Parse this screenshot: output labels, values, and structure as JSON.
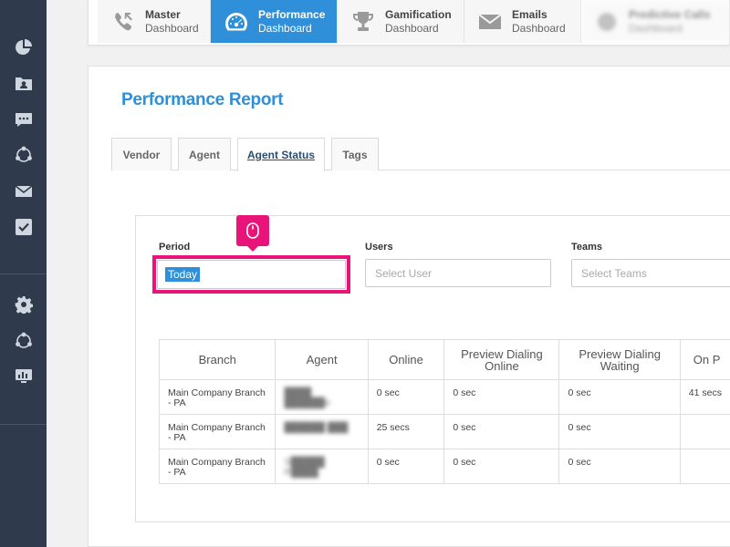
{
  "sidebar": {
    "icons": [
      "pie-chart-icon",
      "contacts-folder-icon",
      "chat-icon",
      "network-icon",
      "mail-icon",
      "checkbox-icon",
      "gear-icon",
      "network-icon",
      "monitor-chart-icon"
    ]
  },
  "dashboard_tabs": [
    {
      "title": "Master",
      "subtitle": "Dashboard",
      "icon": "phone-icon",
      "active": false
    },
    {
      "title": "Performance",
      "subtitle": "Dashboard",
      "icon": "speedometer-icon",
      "active": true
    },
    {
      "title": "Gamification",
      "subtitle": "Dashboard",
      "icon": "trophy-icon",
      "active": false
    },
    {
      "title": "Emails",
      "subtitle": "Dashboard",
      "icon": "envelope-icon",
      "active": false
    },
    {
      "title": "Predictive Calls",
      "subtitle": "Dashboard",
      "icon": "predictive-icon",
      "active": false
    }
  ],
  "page_title": "Performance Report",
  "report_tabs": [
    {
      "label": "Vendor",
      "active": false
    },
    {
      "label": "Agent",
      "active": false
    },
    {
      "label": "Agent Status",
      "active": true
    },
    {
      "label": "Tags",
      "active": false
    }
  ],
  "filters": {
    "period": {
      "label": "Period",
      "value": "Today"
    },
    "users": {
      "label": "Users",
      "placeholder": "Select User"
    },
    "teams": {
      "label": "Teams",
      "placeholder": "Select Teams"
    }
  },
  "table": {
    "headers": [
      "Branch",
      "Agent",
      "Online",
      "Preview Dialing Online",
      "Preview Dialing Waiting",
      "On P"
    ],
    "rows": [
      {
        "branch": "Main Company Branch - PA",
        "agent": "████ ██████e",
        "online": "0 sec",
        "pd_online": "0 sec",
        "pd_waiting": "0 sec",
        "on_p": "41 secs"
      },
      {
        "branch": "Main Company Branch - PA",
        "agent": "██████ ███",
        "online": "25 secs",
        "pd_online": "0 sec",
        "pd_waiting": "0 sec",
        "on_p": ""
      },
      {
        "branch": "Main Company Branch - PA",
        "agent": "S█████ R████",
        "online": "0 sec",
        "pd_online": "0 sec",
        "pd_waiting": "0 sec",
        "on_p": ""
      }
    ]
  },
  "colors": {
    "accent": "#2f8fd8",
    "sidebar": "#2f3b4c",
    "highlight": "#e8147a"
  }
}
